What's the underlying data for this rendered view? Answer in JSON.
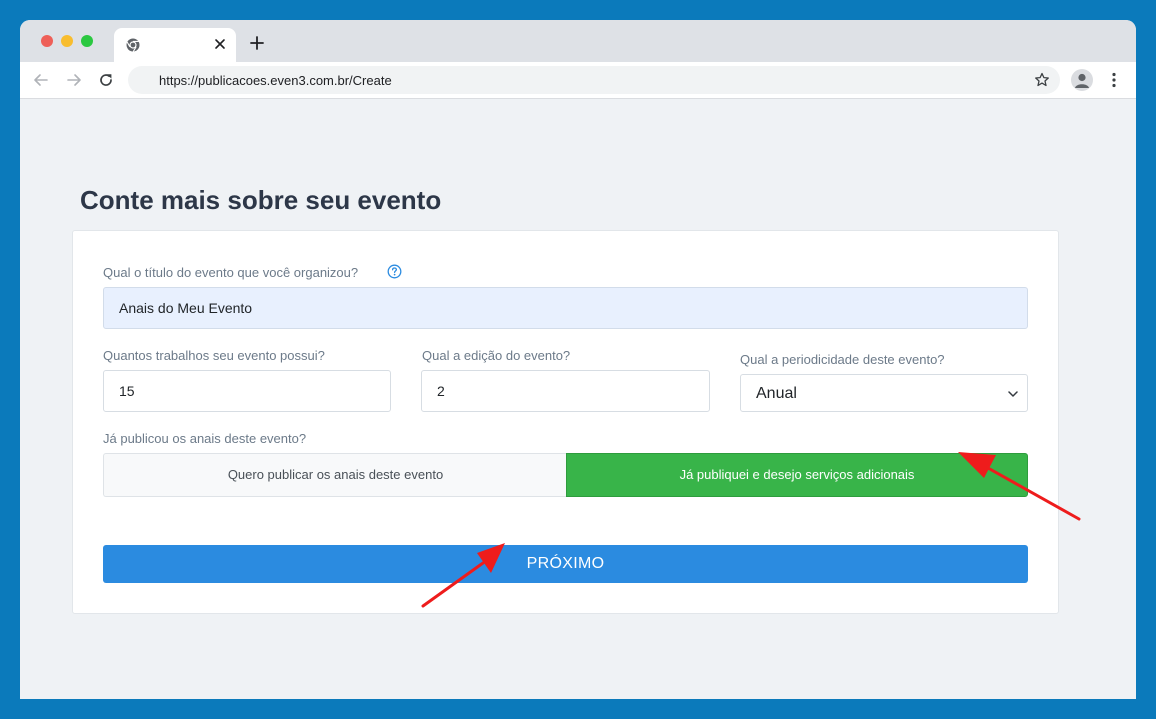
{
  "browser": {
    "url": "https://publicacoes.even3.com.br/Create",
    "tab_title": ""
  },
  "page": {
    "title": "Conte mais sobre seu evento"
  },
  "form": {
    "event_title": {
      "label": "Qual o título do evento que você organizou?",
      "value": "Anais do Meu Evento"
    },
    "works_count": {
      "label": "Quantos trabalhos seu evento possui?",
      "value": "15"
    },
    "edition": {
      "label": "Qual a edição do evento?",
      "value": "2"
    },
    "periodicity": {
      "label": "Qual a periodicidade deste evento?",
      "selected": "Anual"
    },
    "published": {
      "label": "Já publicou os anais deste evento?",
      "options": [
        {
          "label": "Quero publicar os anais deste evento",
          "selected": false
        },
        {
          "label": "Já publiquei e desejo serviços adicionais",
          "selected": true
        }
      ]
    },
    "next_label": "PRÓXIMO"
  },
  "colors": {
    "desktop_background": "#0b7abb",
    "selected_option": "#38b449",
    "primary_button": "#2b8be0",
    "annotation_arrow": "#ee1c1c"
  },
  "icons": [
    "chrome-icon",
    "close-icon",
    "plus-icon",
    "back-arrow-icon",
    "forward-arrow-icon",
    "reload-icon",
    "star-icon",
    "profile-icon",
    "kebab-menu-icon",
    "help-circle-icon",
    "chevron-down-icon"
  ]
}
